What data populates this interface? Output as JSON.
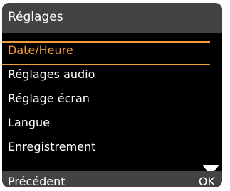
{
  "header": {
    "title": "Réglages"
  },
  "menu": {
    "items": [
      {
        "label": "Date/Heure",
        "selected": true
      },
      {
        "label": "Réglages audio",
        "selected": false
      },
      {
        "label": "Réglage écran",
        "selected": false
      },
      {
        "label": "Langue",
        "selected": false
      },
      {
        "label": "Enregistrement",
        "selected": false
      }
    ],
    "more_below_icon": "scroll-down-triangle-icon"
  },
  "softkeys": {
    "left_label": "Précédent",
    "right_label": "OK"
  },
  "colors": {
    "background": "#000000",
    "bar": "#434343",
    "accent": "#f39c3c",
    "text": "#ffffff"
  }
}
